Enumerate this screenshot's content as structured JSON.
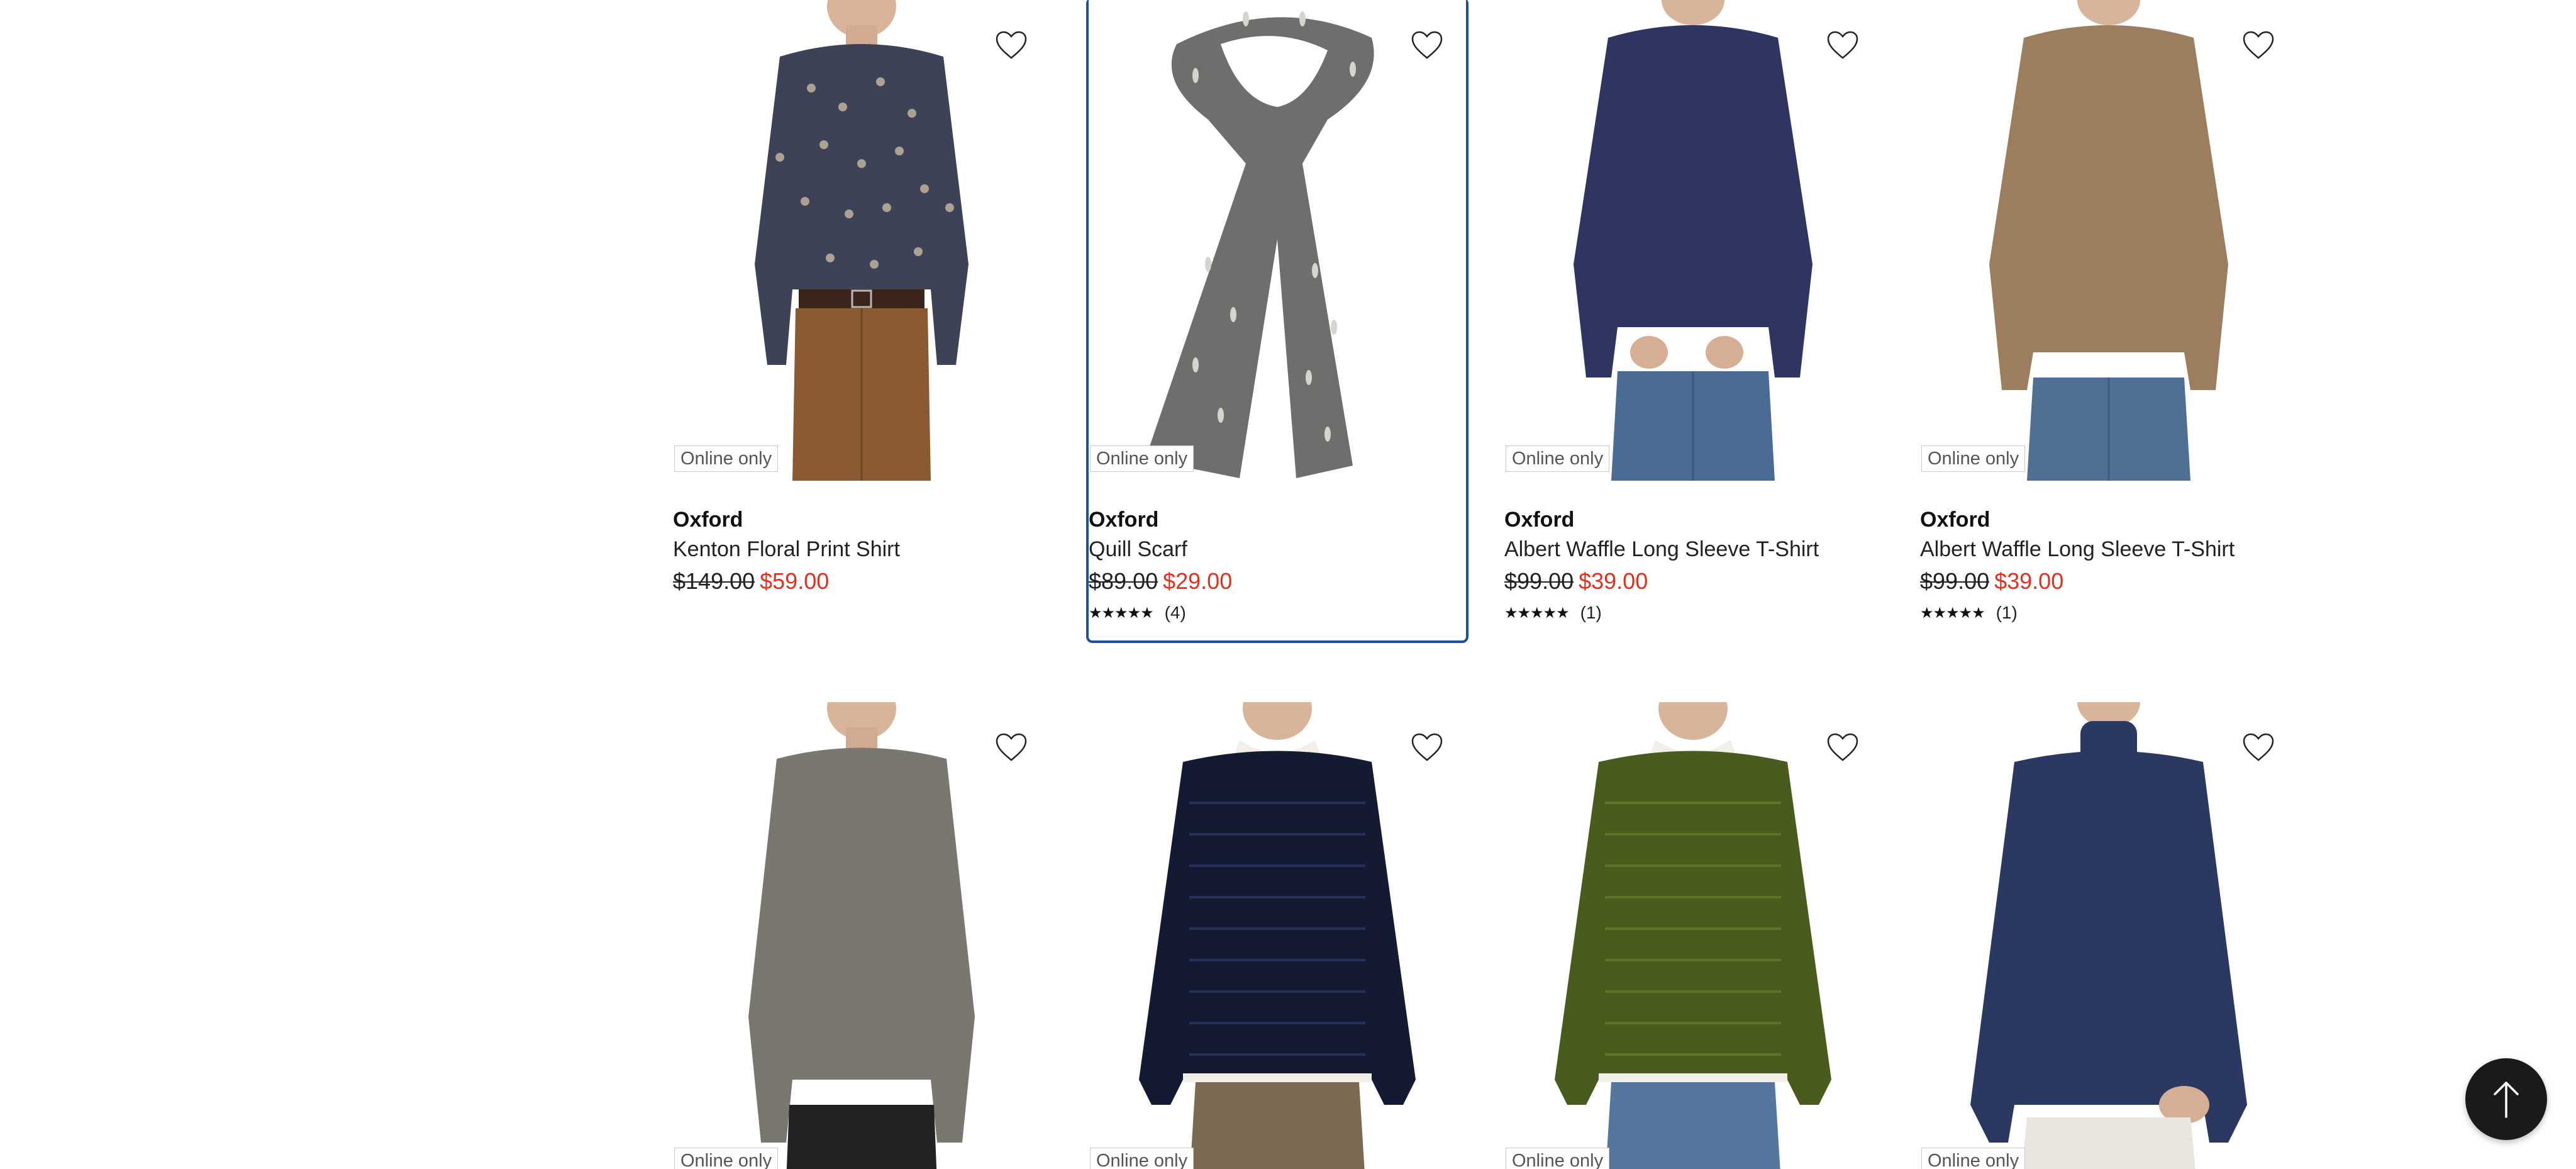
{
  "products": [
    {
      "badge": "Online only",
      "brand": "Oxford",
      "name": "Kenton Floral Print Shirt",
      "was_price": "$149.00",
      "now_price": "$59.00",
      "rating": null,
      "reviews": ""
    },
    {
      "badge": "Online only",
      "brand": "Oxford",
      "name": "Quill Scarf",
      "was_price": "$89.00",
      "now_price": "$29.00",
      "rating": 4.5,
      "reviews": "(4)"
    },
    {
      "badge": "Online only",
      "brand": "Oxford",
      "name": "Albert Waffle Long Sleeve T-Shirt",
      "was_price": "$99.00",
      "now_price": "$39.00",
      "rating": 5,
      "reviews": "(1)"
    },
    {
      "badge": "Online only",
      "brand": "Oxford",
      "name": "Albert Waffle Long Sleeve T-Shirt",
      "was_price": "$99.00",
      "now_price": "$39.00",
      "rating": 5,
      "reviews": "(1)"
    },
    {
      "badge": "Online only"
    },
    {
      "badge": "Online only"
    },
    {
      "badge": "Online only"
    },
    {
      "badge": "Online only"
    }
  ],
  "colors": {
    "sale_price": "#e0311d",
    "selected_outline": "#1c4fa3",
    "back_to_top_bg": "#1a1a1a"
  },
  "icons": {
    "wishlist": "heart-outline-icon",
    "back_to_top": "arrow-up-icon",
    "rating": "star-icon"
  }
}
